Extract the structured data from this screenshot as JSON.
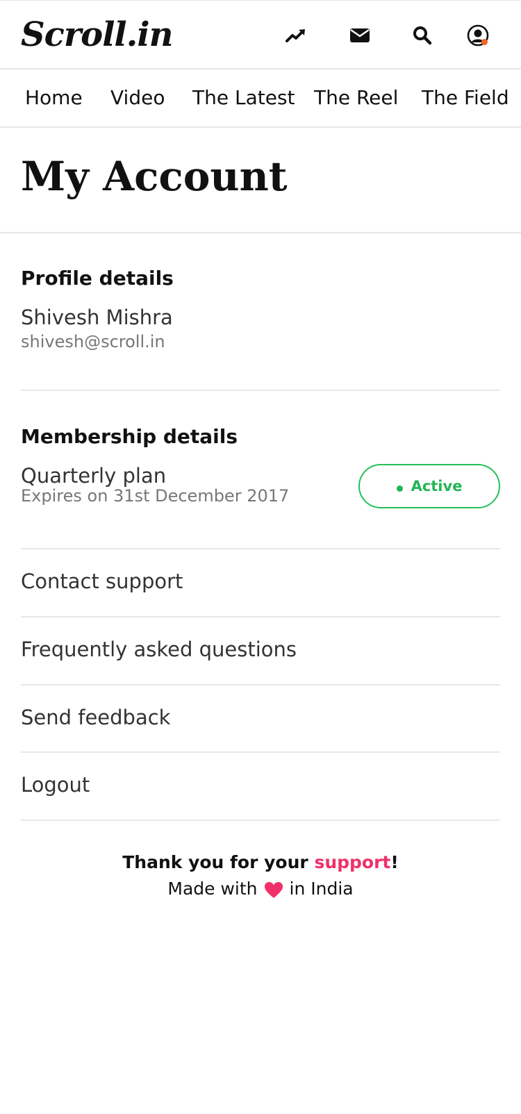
{
  "header": {
    "logo_text": "Scroll.in",
    "icons": [
      "trending-icon",
      "mail-icon",
      "search-icon",
      "account-icon"
    ],
    "notification_dot_color": "#f26522"
  },
  "nav": {
    "items": [
      {
        "label": "Home"
      },
      {
        "label": "Video"
      },
      {
        "label": "The Latest"
      },
      {
        "label": "The Reel"
      },
      {
        "label": "The Field"
      }
    ]
  },
  "page": {
    "title": "My Account"
  },
  "profile": {
    "heading": "Profile details",
    "name": "Shivesh Mishra",
    "email": "shivesh@scroll.in"
  },
  "membership": {
    "heading": "Membership details",
    "plan": "Quarterly plan",
    "expiry": "Expires on 31st December 2017",
    "status": "Active",
    "status_color": "#22b554"
  },
  "menu": {
    "items": [
      {
        "label": "Contact support"
      },
      {
        "label": "Frequently asked questions"
      },
      {
        "label": "Send feedback"
      },
      {
        "label": "Logout"
      }
    ]
  },
  "footer": {
    "thanks_prefix": "Thank you for your ",
    "thanks_link": "support",
    "thanks_suffix": "!",
    "made_prefix": "Made with",
    "made_suffix": "in India",
    "accent_color": "#f0306b"
  }
}
